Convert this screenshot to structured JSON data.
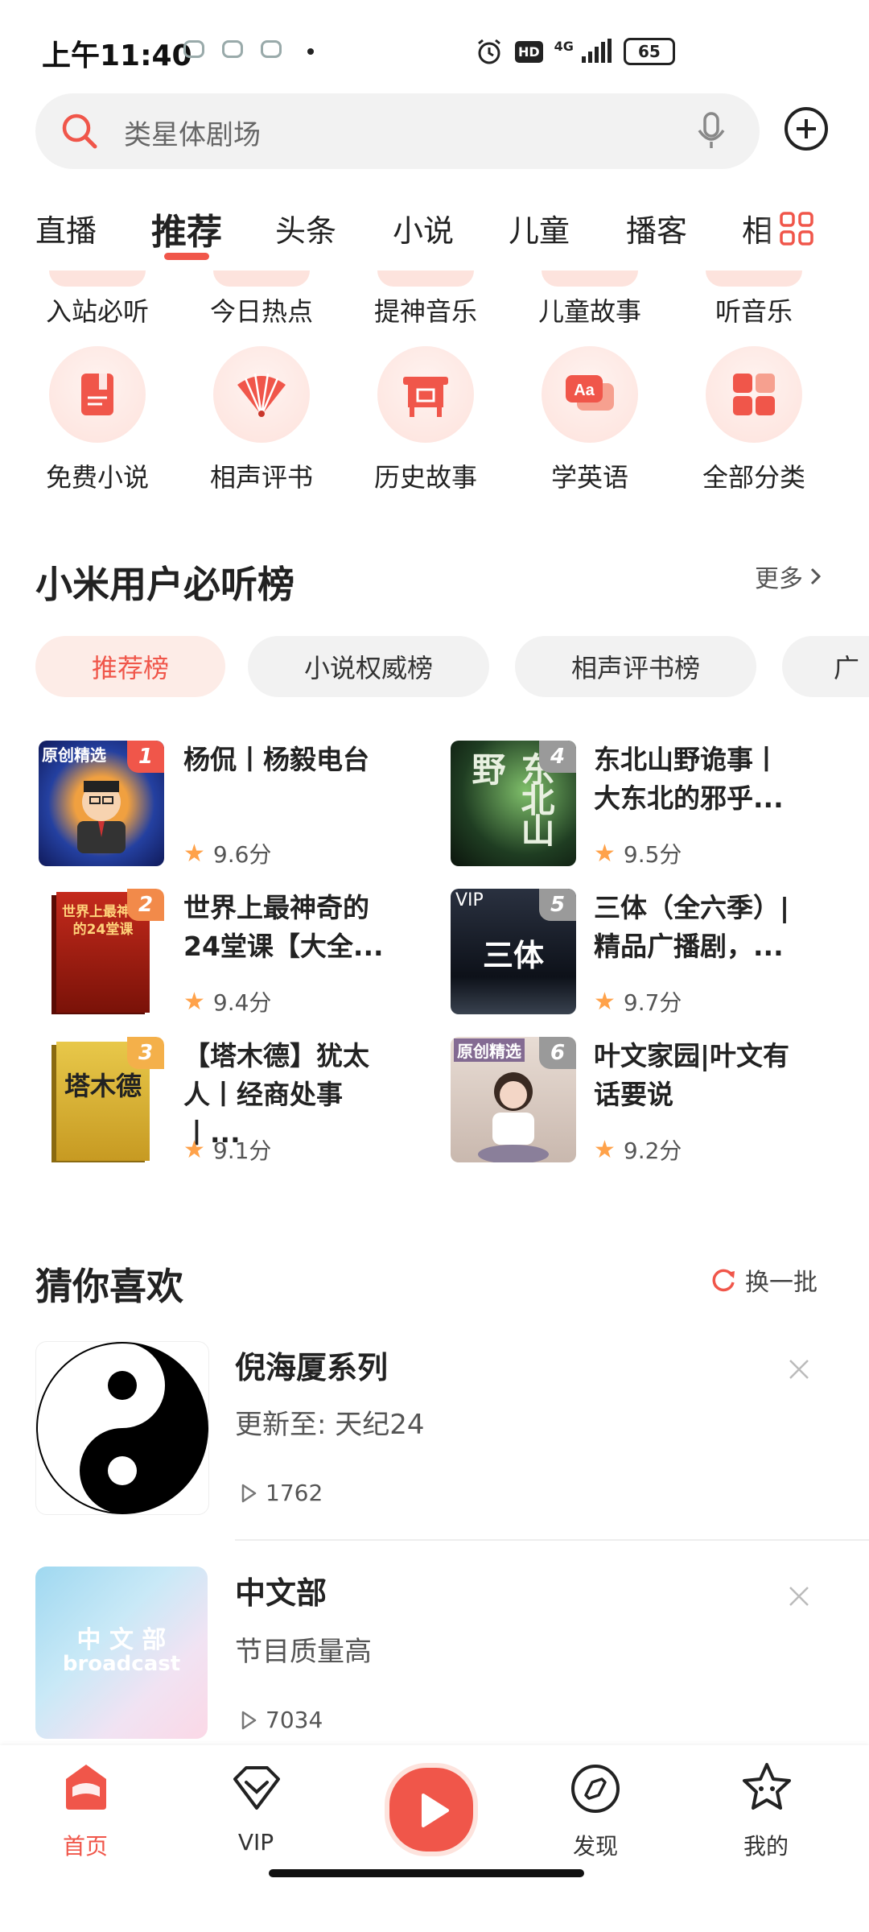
{
  "status_bar": {
    "time": "上午11:40",
    "network": "4G",
    "battery": "65",
    "hd": "HD"
  },
  "search": {
    "placeholder": "类星体剧场"
  },
  "tabs": [
    {
      "label": "直播"
    },
    {
      "label": "推荐"
    },
    {
      "label": "头条"
    },
    {
      "label": "小说"
    },
    {
      "label": "儿童"
    },
    {
      "label": "播客"
    },
    {
      "label": "相"
    }
  ],
  "categories_row1": [
    {
      "label": "入站必听"
    },
    {
      "label": "今日热点"
    },
    {
      "label": "提神音乐"
    },
    {
      "label": "儿童故事"
    },
    {
      "label": "听音乐"
    }
  ],
  "categories_row2": [
    {
      "label": "免费小说",
      "icon": "book-icon"
    },
    {
      "label": "相声评书",
      "icon": "fan-icon"
    },
    {
      "label": "历史故事",
      "icon": "bronze-vessel-icon"
    },
    {
      "label": "学英语",
      "icon": "english-icon"
    },
    {
      "label": "全部分类",
      "icon": "all-categories-icon"
    }
  ],
  "ranking": {
    "title": "小米用户必听榜",
    "more": "更多",
    "chips": [
      {
        "label": "推荐榜"
      },
      {
        "label": "小说权威榜"
      },
      {
        "label": "相声评书榜"
      },
      {
        "label": "广"
      }
    ],
    "items": [
      {
        "rank": "1",
        "title": "杨侃丨杨毅电台",
        "score": "9.6分",
        "cover_tag": "原创精选"
      },
      {
        "rank": "4",
        "title": "东北山野诡事丨大东北的邪乎...",
        "score": "9.5分",
        "cover_text": "东北山野"
      },
      {
        "rank": "2",
        "title": "世界上最神奇的24堂课【大全...",
        "score": "9.4分",
        "cover_text": "世界上最神奇的24堂课"
      },
      {
        "rank": "5",
        "title": "三体（全六季）| 精品广播剧，...",
        "score": "9.7分",
        "cover_tag": "VIP",
        "cover_text": "三体"
      },
      {
        "rank": "3",
        "title": "【塔木德】犹太人丨经商处事丨...",
        "score": "9.1分",
        "cover_text": "塔木德"
      },
      {
        "rank": "6",
        "title": "叶文家园|叶文有话要说",
        "score": "9.2分",
        "cover_tag": "原创精选"
      }
    ]
  },
  "guess": {
    "title": "猜你喜欢",
    "refresh": "换一批",
    "items": [
      {
        "title": "倪海厦系列",
        "subtitle": "更新至: 天纪24",
        "plays": "1762"
      },
      {
        "title": "中文部",
        "subtitle": "节目质量高",
        "plays": "7034",
        "cover_text": "中 文 部",
        "cover_sub": "broadcast"
      }
    ]
  },
  "nav": [
    {
      "label": "首页"
    },
    {
      "label": "VIP"
    },
    {
      "label": "发现"
    },
    {
      "label": "我的"
    }
  ],
  "colors": {
    "accent": "#f0564a",
    "star": "#ffa24a"
  }
}
